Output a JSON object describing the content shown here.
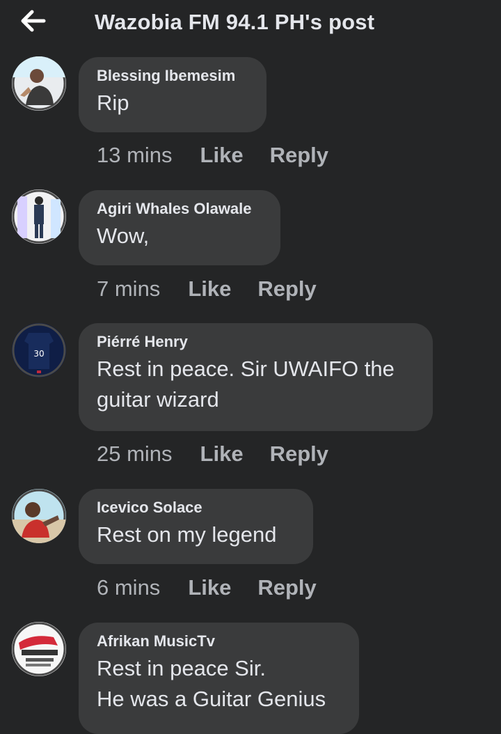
{
  "header": {
    "title": "Wazobia FM 94.1 PH's post",
    "back_icon": "arrow-left-icon"
  },
  "colors": {
    "background": "#242526",
    "bubble": "#3a3b3c",
    "text": "#e4e6eb",
    "meta": "#b0b3b8"
  },
  "actions": {
    "like": "Like",
    "reply": "Reply"
  },
  "comments": [
    {
      "author": "Blessing Ibemesim",
      "lines": [
        "Rip"
      ],
      "time": "13 mins"
    },
    {
      "author": "Agiri Whales Olawale",
      "lines": [
        "Wow,"
      ],
      "time": "7 mins"
    },
    {
      "author": "Piérré Henry",
      "lines": [
        "Rest in peace. Sir UWAIFO  the",
        "guitar wizard"
      ],
      "time": "25 mins"
    },
    {
      "author": "Icevico Solace",
      "lines": [
        "Rest on my legend"
      ],
      "time": "6 mins"
    },
    {
      "author": "Afrikan MusicTv",
      "lines": [
        "Rest in peace Sir.",
        "He was a Guitar Genius"
      ],
      "time": ""
    }
  ]
}
